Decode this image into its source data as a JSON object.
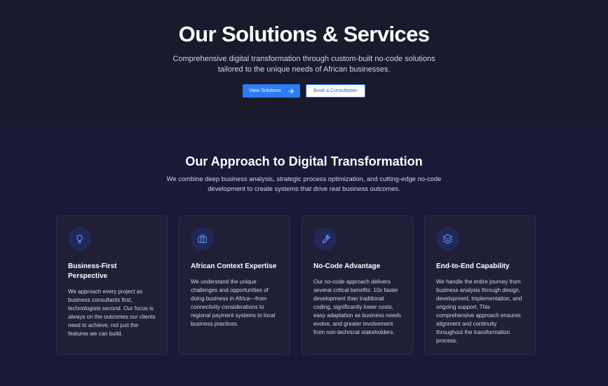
{
  "hero": {
    "title": "Our Solutions & Services",
    "subtitle_line1": "Comprehensive digital transformation through custom-built no-code solutions",
    "subtitle_line2": "tailored to the unique needs of African businesses.",
    "primary_button": "View Solutions",
    "secondary_button": "Book a Consultation"
  },
  "approach": {
    "title": "Our Approach to Digital Transformation",
    "lead_line1": "We combine deep business analysis, strategic process optimization, and cutting-edge no-code",
    "lead_line2": "development to create systems that drive real business outcomes.",
    "cards": [
      {
        "icon": "lightbulb-icon",
        "title": "Business-First Perspective",
        "text": "We approach every project as business consultants first, technologists second. Our focus is always on the outcomes our clients need to achieve, not just the features we can build."
      },
      {
        "icon": "briefcase-icon",
        "title": "African Context Expertise",
        "text": "We understand the unique challenges and opportunities of doing business in Africa—from connectivity considerations to regional payment systems to local business practices."
      },
      {
        "icon": "wrench-icon",
        "title": "No-Code Advantage",
        "text": "Our no-code approach delivers several critical benefits: 10x faster development than traditional coding, significantly lower costs, easy adaptation as business needs evolve, and greater involvement from non-technical stakeholders."
      },
      {
        "icon": "layers-icon",
        "title": "End-to-End Capability",
        "text": "We handle the entire journey from business analysis through design, development, implementation, and ongoing support. This comprehensive approach ensures alignment and continuity throughout the transformation process."
      }
    ]
  },
  "colors": {
    "hero_bg": "#191a2b",
    "section_bg": "#181a38",
    "accent": "#2b7cf6",
    "card_bg": "#1f2037"
  }
}
